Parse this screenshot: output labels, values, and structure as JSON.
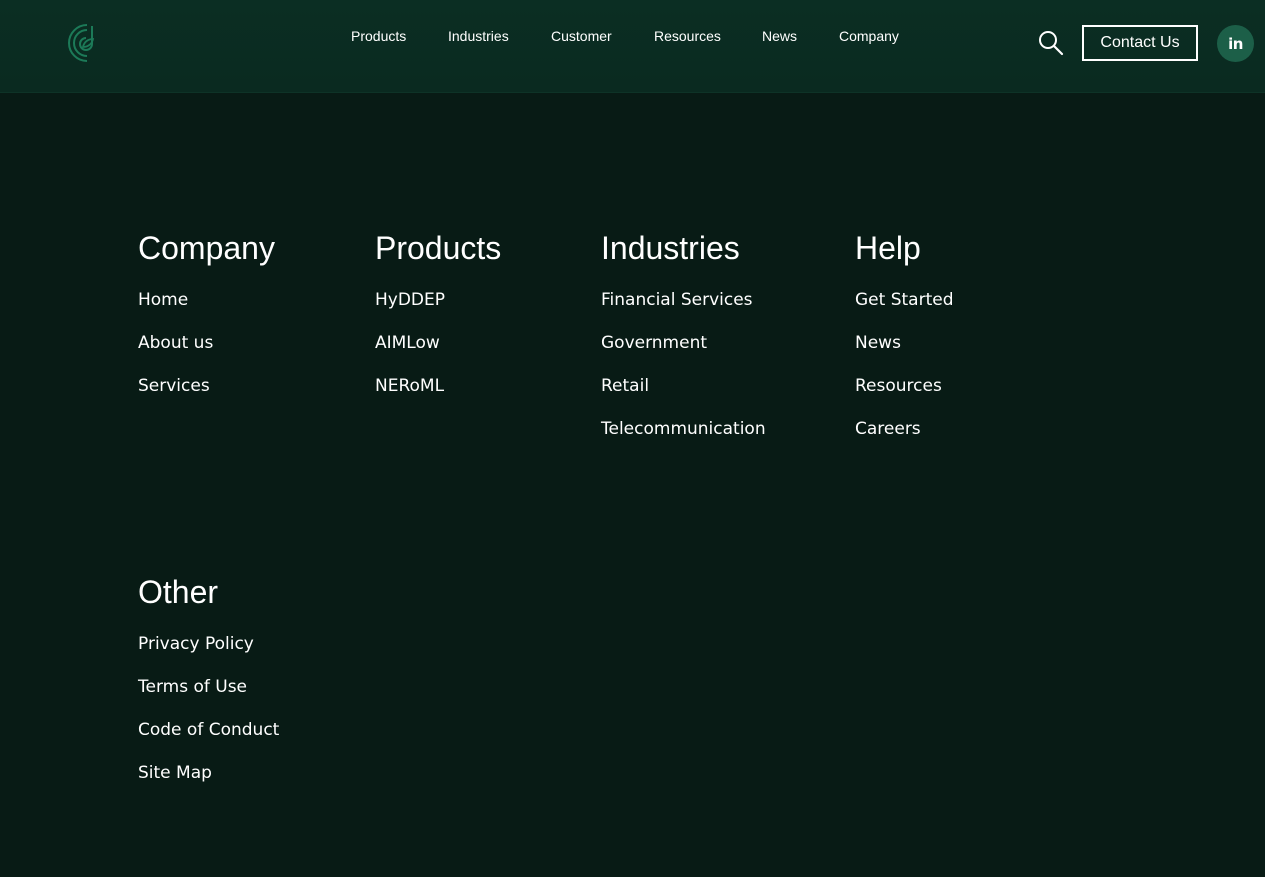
{
  "header": {
    "nav": [
      "Products",
      "Industries",
      "Customer",
      "Resources",
      "News",
      "Company"
    ],
    "contact_label": "Contact Us",
    "linkedin_label": "in"
  },
  "colors": {
    "background": "#081b15",
    "header": "#0b2e23",
    "accent": "#1c5f48"
  },
  "icons": {
    "logo": "leaf-logo-icon",
    "search": "search-icon",
    "social": "linkedin-icon"
  },
  "footer": {
    "columns": [
      {
        "title": "Company",
        "links": [
          "Home",
          "About us",
          "Services"
        ]
      },
      {
        "title": "Products",
        "links": [
          "HyDDEP",
          "AIMLow",
          "NERoML"
        ]
      },
      {
        "title": "Industries",
        "links": [
          "Financial Services",
          "Government",
          "Retail",
          "Telecommunication"
        ]
      },
      {
        "title": "Help",
        "links": [
          "Get Started",
          "News",
          "Resources",
          "Careers"
        ]
      },
      {
        "title": "Other",
        "links": [
          "Privacy Policy",
          "Terms of Use",
          "Code of Conduct",
          "Site Map"
        ]
      }
    ]
  }
}
